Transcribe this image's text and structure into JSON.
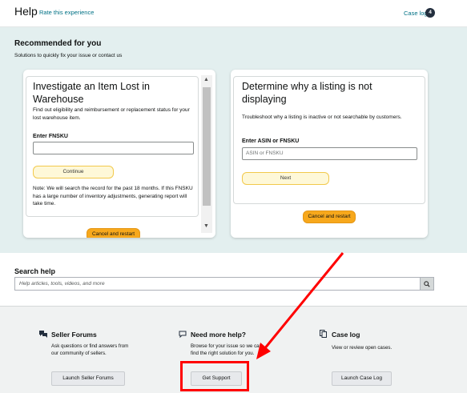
{
  "header": {
    "title": "Help",
    "rate_link": "Rate this experience",
    "case_log_link": "Case log",
    "case_log_count": "4"
  },
  "recommended": {
    "heading": "Recommended for you",
    "subtitle": "Solutions to quickly fix your issue or contact us",
    "card1": {
      "title": "Investigate an Item Lost in Warehouse",
      "description": "Find out eligibility and reimbursement or replacement status for your lost warehouse item.",
      "field_label": "Enter FNSKU",
      "field_value": "",
      "continue_label": "Continue",
      "note": "Note: We will search the record for the past 18 months. If this FNSKU has a large number of inventory adjustments, generating report will take time.",
      "cancel_label": "Cancel and restart"
    },
    "card2": {
      "title": "Determine why a listing is not displaying",
      "description": "Troubleshoot why a listing is inactive or not searchable by customers.",
      "field_label": "Enter ASIN or FNSKU",
      "field_placeholder": "ASIN or FNSKU",
      "next_label": "Next",
      "cancel_label": "Cancel and restart"
    }
  },
  "search": {
    "heading": "Search help",
    "placeholder": "Help articles, tools, videos, and more"
  },
  "footer": {
    "forums": {
      "title": "Seller Forums",
      "description": "Ask questions or find answers from our community of sellers.",
      "button": "Launch Seller Forums"
    },
    "more_help": {
      "title": "Need more help?",
      "description": "Browse for your issue so we can find the right solution for you.",
      "button": "Get Support"
    },
    "case_log": {
      "title": "Case log",
      "description": "View or review open cases.",
      "button": "Launch Case Log"
    }
  },
  "colors": {
    "link": "#007185",
    "recommended_bg": "#e3efef",
    "orange_button": "#f7a81c",
    "light_button": "#fef8d8",
    "annotation_red": "#ff0000"
  }
}
